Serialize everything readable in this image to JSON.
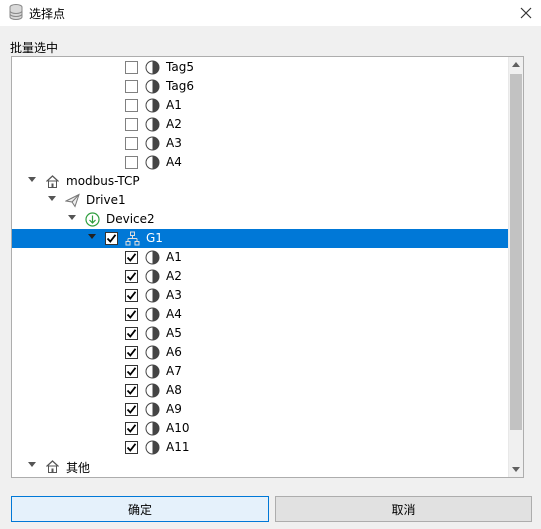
{
  "window": {
    "title": "选择点"
  },
  "group_label": "批量选中",
  "tree": [
    {
      "label": "Tag5",
      "depth": 4,
      "kind": "point",
      "checkbox": true,
      "checked": false
    },
    {
      "label": "Tag6",
      "depth": 4,
      "kind": "point",
      "checkbox": true,
      "checked": false
    },
    {
      "label": "A1",
      "depth": 4,
      "kind": "point",
      "checkbox": true,
      "checked": false
    },
    {
      "label": "A2",
      "depth": 4,
      "kind": "point",
      "checkbox": true,
      "checked": false
    },
    {
      "label": "A3",
      "depth": 4,
      "kind": "point",
      "checkbox": true,
      "checked": false
    },
    {
      "label": "A4",
      "depth": 4,
      "kind": "point",
      "checkbox": true,
      "checked": false
    },
    {
      "label": "modbus-TCP",
      "depth": 0,
      "kind": "home",
      "expandable": true
    },
    {
      "label": "Drive1",
      "depth": 1,
      "kind": "driver",
      "expandable": true
    },
    {
      "label": "Device2",
      "depth": 2,
      "kind": "device",
      "expandable": true
    },
    {
      "label": "G1",
      "depth": 3,
      "kind": "group",
      "expandable": true,
      "checkbox": true,
      "checked": true,
      "selected": true
    },
    {
      "label": "A1",
      "depth": 4,
      "kind": "point",
      "checkbox": true,
      "checked": true
    },
    {
      "label": "A2",
      "depth": 4,
      "kind": "point",
      "checkbox": true,
      "checked": true
    },
    {
      "label": "A3",
      "depth": 4,
      "kind": "point",
      "checkbox": true,
      "checked": true
    },
    {
      "label": "A4",
      "depth": 4,
      "kind": "point",
      "checkbox": true,
      "checked": true
    },
    {
      "label": "A5",
      "depth": 4,
      "kind": "point",
      "checkbox": true,
      "checked": true
    },
    {
      "label": "A6",
      "depth": 4,
      "kind": "point",
      "checkbox": true,
      "checked": true
    },
    {
      "label": "A7",
      "depth": 4,
      "kind": "point",
      "checkbox": true,
      "checked": true
    },
    {
      "label": "A8",
      "depth": 4,
      "kind": "point",
      "checkbox": true,
      "checked": true
    },
    {
      "label": "A9",
      "depth": 4,
      "kind": "point",
      "checkbox": true,
      "checked": true
    },
    {
      "label": "A10",
      "depth": 4,
      "kind": "point",
      "checkbox": true,
      "checked": true
    },
    {
      "label": "A11",
      "depth": 4,
      "kind": "point",
      "checkbox": true,
      "checked": true
    },
    {
      "label": "其他",
      "depth": 0,
      "kind": "home",
      "expandable": true
    }
  ],
  "buttons": {
    "ok": "确定",
    "cancel": "取消"
  },
  "colors": {
    "selection": "#0078d7",
    "device_icon": "#2e9e3e",
    "ok_border": "#0078d7"
  }
}
